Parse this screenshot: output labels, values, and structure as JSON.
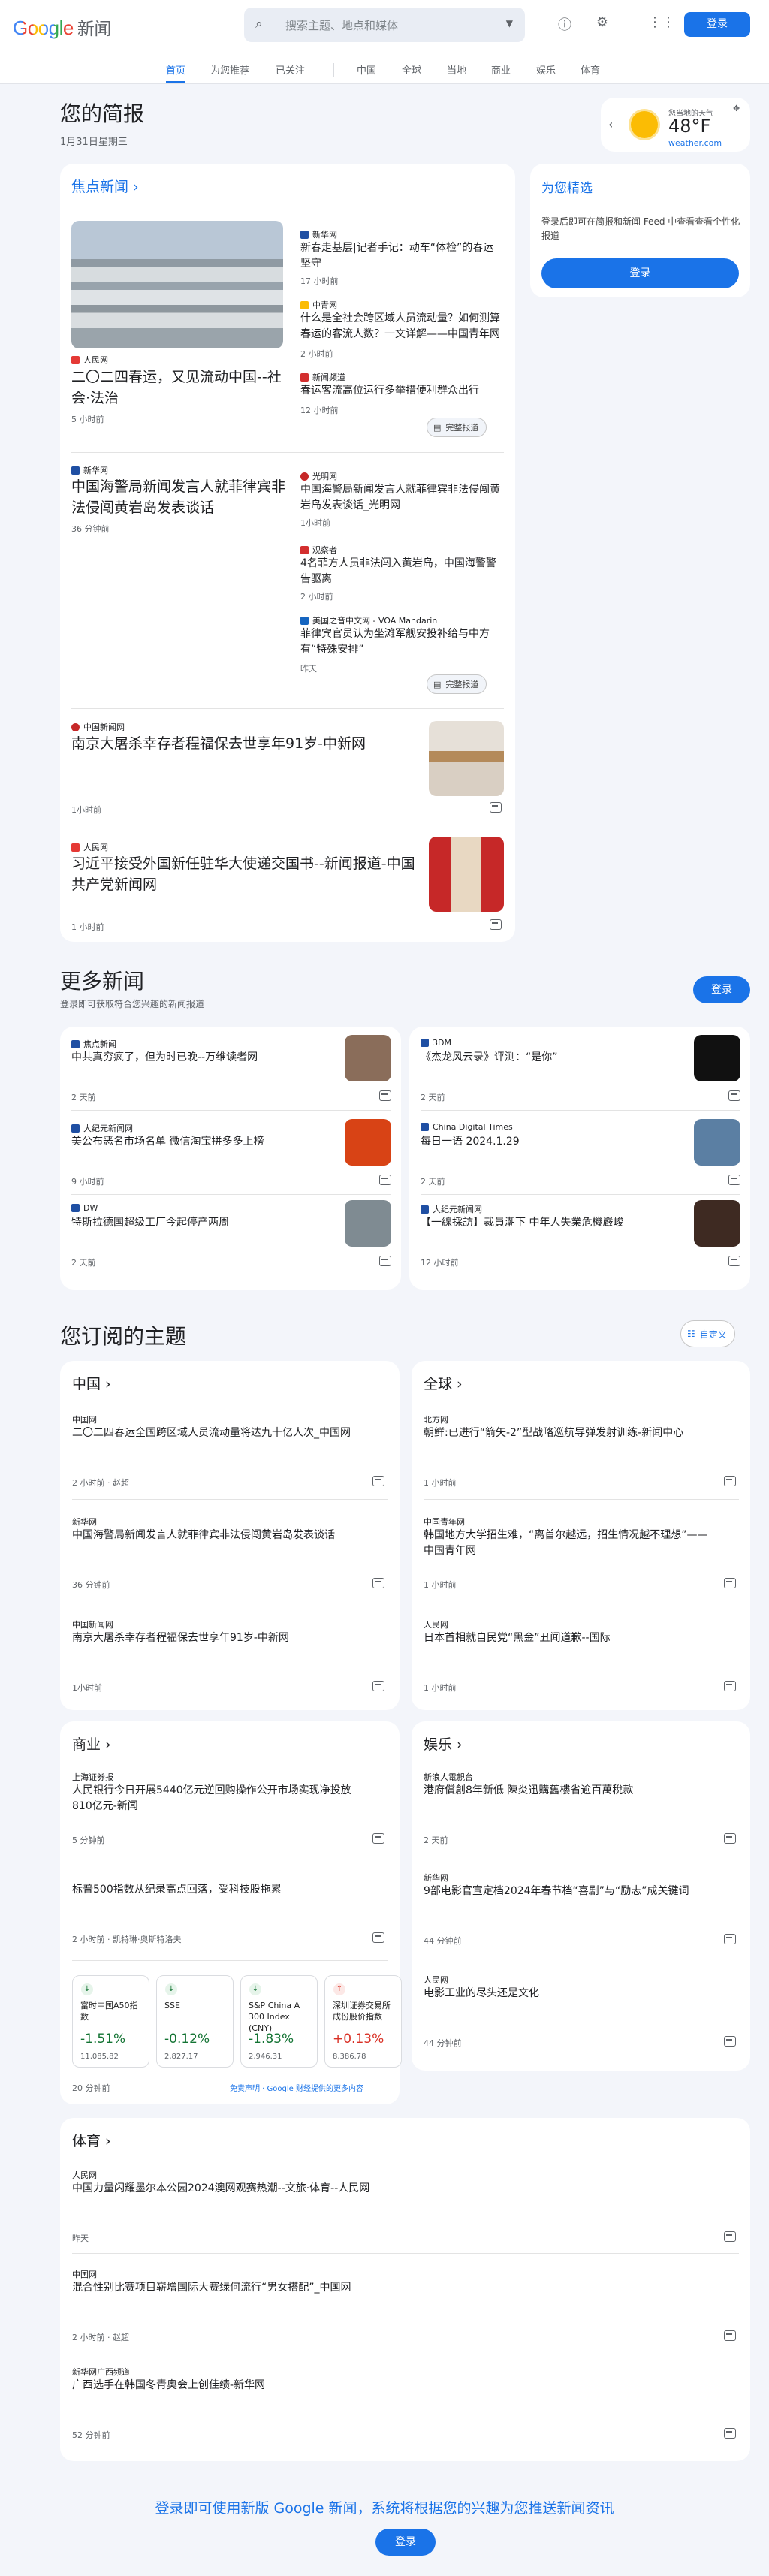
{
  "header": {
    "logo_google": "Google",
    "logo_news": "新闻",
    "search_placeholder": "搜索主题、地点和媒体",
    "sign_in": "登录"
  },
  "nav": [
    "首页",
    "为您推荐",
    "已关注",
    "中国",
    "全球",
    "当地",
    "商业",
    "娱乐",
    "体育"
  ],
  "briefing": {
    "title": "您的简报",
    "date": "1月31日星期三"
  },
  "weather": {
    "label": "您当地的天气",
    "temp": "48°F",
    "source": "weather.com"
  },
  "top": {
    "title": "焦点新闻 ›",
    "s1": {
      "source": "人民网",
      "headline": "二〇二四春运，又见流动中国--社会·法治",
      "time": "5 小时前",
      "r1": {
        "source": "新华网",
        "title": "新春走基层|记者手记：动车“体检”的春运坚守",
        "time": "17 小时前"
      },
      "r2": {
        "source": "中青网",
        "title": "什么是全社会跨区域人员流动量？如何测算春运的客流人数？一文详解——中国青年网",
        "time": "2 小时前"
      },
      "r3": {
        "source": "新闻频道",
        "title": "春运客流高位运行多举措便利群众出行",
        "time": "12 小时前"
      }
    },
    "s2": {
      "source": "新华网",
      "headline": "中国海警局新闻发言人就菲律宾非法侵闯黄岩岛发表谈话",
      "time": "36 分钟前",
      "r1": {
        "source": "光明网",
        "title": "中国海警局新闻发言人就菲律宾非法侵闯黄岩岛发表谈话_光明网",
        "time": "1小时前"
      },
      "r2": {
        "source": "观察者",
        "title": "4名菲方人员非法闯入黄岩岛，中国海警警告驱离",
        "time": "2 小时前"
      },
      "r3": {
        "source": "美国之音中文网 - VOA Mandarin",
        "title": "菲律宾官员认为坐滩军舰安投补给与中方有“特殊安排”",
        "time": "昨天"
      }
    },
    "full_coverage": "完整报道",
    "s3": {
      "source": "中国新闻网",
      "title": "南京大屠杀幸存者程福保去世享年91岁-中新网",
      "time": "1小时前"
    },
    "s4": {
      "source": "人民网",
      "title": "习近平接受外国新任驻华大使递交国书--新闻报道-中国共产党新闻网",
      "time": "1 小时前"
    }
  },
  "foryou": {
    "title": "为您精选",
    "desc": "登录后即可在简报和新闻 Feed 中查看查看个性化报道",
    "btn": "登录"
  },
  "more": {
    "title": "更多新闻",
    "sub": "登录即可获取符合您兴趣的新闻报道",
    "btn": "登录",
    "items": [
      {
        "source": "焦点新闻",
        "title": "中共真穷疯了，但为时已晚--万维读者网",
        "time": "2 天前"
      },
      {
        "source": "3DM",
        "title": "《杰龙风云录》评测：“是你”",
        "time": "2 天前"
      },
      {
        "source": "大纪元新闻网",
        "title": "美公布恶名市场名单 微信淘宝拼多多上榜",
        "time": "9 小时前"
      },
      {
        "source": "China Digital Times",
        "title": "每日一语 2024.1.29",
        "time": "2 天前"
      },
      {
        "source": "DW",
        "title": "特斯拉德国超级工厂今起停产两周",
        "time": "2 天前"
      },
      {
        "source": "大纪元新闻网",
        "title": "【一線採訪】裁員潮下 中年人失業危機嚴峻",
        "time": "12 小时前"
      }
    ]
  },
  "topics": {
    "title": "您订阅的主题",
    "customize": "自定义"
  },
  "china": {
    "title": "中国 ›",
    "items": [
      {
        "source": "中国网",
        "title": "二〇二四春运全国跨区域人员流动量将达九十亿人次_中国网",
        "time": "2 小时前 · 赵超"
      },
      {
        "source": "新华网",
        "title": "中国海警局新闻发言人就菲律宾非法侵闯黄岩岛发表谈话",
        "time": "36 分钟前"
      },
      {
        "source": "中国新闻网",
        "title": "南京大屠杀幸存者程福保去世享年91岁-中新网",
        "time": "1小时前"
      }
    ]
  },
  "world": {
    "title": "全球 ›",
    "items": [
      {
        "source": "北方网",
        "title": "朝鲜:已进行“箭矢-2”型战略巡航导弹发射训练-新闻中心",
        "time": "1 小时前"
      },
      {
        "source": "中国青年网",
        "title": "韩国地方大学招生难，“离首尔越远，招生情况越不理想”——中国青年网",
        "time": "1 小时前"
      },
      {
        "source": "人民网",
        "title": "日本首相就自民党“黑金”丑闻道歉--国际",
        "time": "1 小时前"
      }
    ]
  },
  "business": {
    "title": "商业 ›",
    "items": [
      {
        "source": "上海证券报",
        "title": "人民银行今日开展5440亿元逆回购操作公开市场实现净投放810亿元-新闻",
        "time": "5 分钟前"
      },
      {
        "source": "",
        "title": "标普500指数从纪录高点回落，受科技股拖累",
        "time": "2 小时前 · 凯特琳·奥斯特洛夫"
      }
    ],
    "tiles": [
      {
        "name": "富时中国A50指数",
        "pct": "-1.51%",
        "val": "11,085.82",
        "up": false
      },
      {
        "name": "SSE",
        "pct": "-0.12%",
        "val": "2,827.17",
        "up": false
      },
      {
        "name": "S&P China A 300 Index (CNY)",
        "pct": "-1.83%",
        "val": "2,946.31",
        "up": false
      },
      {
        "name": "深圳证券交易所成份股价指数",
        "pct": "+0.13%",
        "val": "8,386.78",
        "up": true
      }
    ],
    "time": "20 分钟前",
    "disclaimer": "免责声明 · Google 财经提供的更多内容"
  },
  "ent": {
    "title": "娱乐 ›",
    "items": [
      {
        "source": "新浪人電親台",
        "title": "港府償創8年新低 陳炎迅購舊樓省逾百萬稅款",
        "time": "2 天前"
      },
      {
        "source": "新华网",
        "title": "9部电影官宣定档2024年春节档“喜剧”与“励志”成关键词",
        "time": "44 分钟前"
      },
      {
        "source": "人民网",
        "title": "电影工业的尽头还是文化",
        "time": "44 分钟前"
      }
    ]
  },
  "sports": {
    "title": "体育 ›",
    "items": [
      {
        "source": "人民网",
        "title": "中国力量闪耀墨尔本公园2024澳网观赛热潮--文旅·体育--人民网",
        "time": "昨天"
      },
      {
        "source": "中国网",
        "title": "混合性别比赛项目崭增国际大赛绿何流行“男女搭配”_中国网",
        "time": "2 小时前 · 赵超"
      },
      {
        "source": "新华网广西频道",
        "title": "广西选手在韩国冬青奥会上创佳绩-新华网",
        "time": "52 分钟前"
      }
    ]
  },
  "footer": {
    "text": "登录即可使用新版 Google 新闻，系统将根据您的兴趣为您推送新闻资讯",
    "btn": "登录"
  }
}
